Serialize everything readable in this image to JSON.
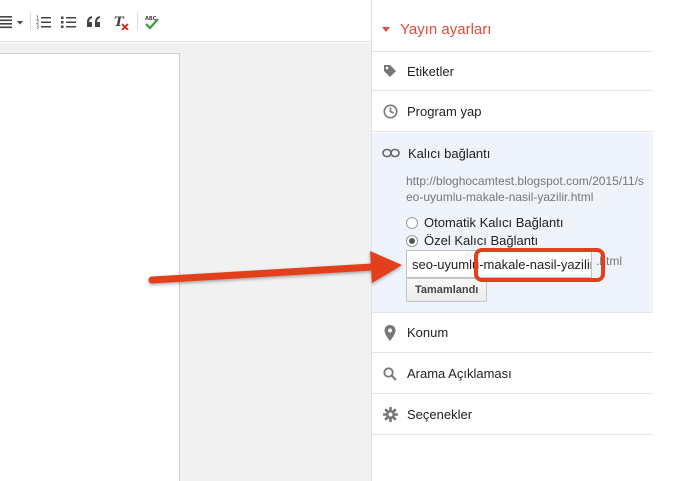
{
  "toolbar": {
    "buttons": [
      {
        "name": "align-icon"
      },
      {
        "name": "numbered-list-icon"
      },
      {
        "name": "bulleted-list-icon"
      },
      {
        "name": "quote-icon"
      },
      {
        "name": "remove-formatting-icon"
      },
      {
        "name": "spellcheck-icon",
        "label": "ABC"
      }
    ]
  },
  "panel": {
    "title": "Yayın ayarları",
    "labels": "Etiketler",
    "schedule": "Program yap",
    "permalink": {
      "title": "Kalıcı bağlantı",
      "url": "http://bloghocamtest.blogspot.com/2015/11/seo-uyumlu-makale-nasil-yazilir.html",
      "option_auto": "Otomatik Kalıcı Bağlantı",
      "option_custom": "Özel Kalıcı Bağlantı",
      "selected": "Özel Kalıcı Bağlantı",
      "slug_value": "seo-uyumlu-makale-nasil-yazilir",
      "slug_suffix": ".html",
      "done_button": "Tamamlandı"
    },
    "location": "Konum",
    "search_description": "Arama Açıklaması",
    "options": "Seçenekler"
  },
  "colors": {
    "accent": "#dd4b39",
    "annotation": "#e2401c",
    "permalink_bg": "#eef3fc"
  }
}
